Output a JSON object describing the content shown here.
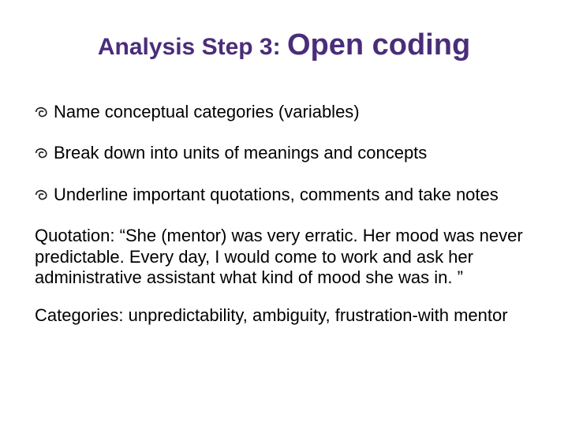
{
  "title": {
    "prefix": "Analysis Step 3: ",
    "main": "Open coding"
  },
  "bullets": [
    "Name conceptual categories (variables)",
    "Break down into units of meanings and concepts",
    "Underline important quotations, comments and take notes"
  ],
  "quotation": "Quotation:  “She (mentor) was very erratic. Her mood was never predictable. Every day, I would come to work and ask her administrative assistant what kind of mood she was in. ”",
  "categories": "Categories: unpredictability, ambiguity,  frustration-with mentor"
}
